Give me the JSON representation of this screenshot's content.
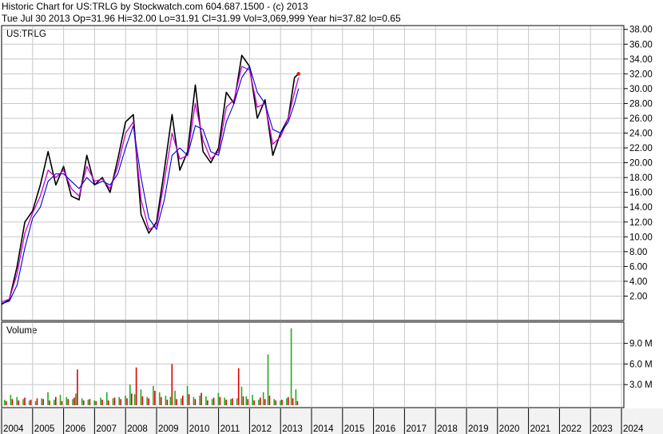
{
  "header": {
    "line1": "Historic Chart for US:TRLG by Stockwatch.com 604.687.1500 - (c) 2013",
    "line2": "Tue Jul 30 2013   Op=31.96   Hi=32.00   Lo=31.91   Cl=31.99   Vol=3,069,999   Year hi=37.82   lo=0.65"
  },
  "colors": {
    "price": "#000000",
    "ma_fast": "#cc00cc",
    "ma_slow": "#0000cc",
    "volume_up": "#22aa22",
    "volume_down": "#dd0000",
    "grid": "#c8c8c8"
  },
  "chart_data": [
    {
      "type": "line",
      "label": "US:TRLG",
      "ylim": [
        0,
        39
      ],
      "y_ticks": [
        "2.00",
        "4.00",
        "6.00",
        "8.00",
        "10.00",
        "12.00",
        "14.00",
        "16.00",
        "18.00",
        "20.00",
        "22.00",
        "24.00",
        "26.00",
        "28.00",
        "30.00",
        "32.00",
        "34.00",
        "36.00",
        "38.00"
      ],
      "x": [
        2004.0,
        2004.25,
        2004.5,
        2004.75,
        2005.0,
        2005.25,
        2005.5,
        2005.75,
        2006.0,
        2006.25,
        2006.5,
        2006.75,
        2007.0,
        2007.25,
        2007.5,
        2007.75,
        2008.0,
        2008.25,
        2008.5,
        2008.75,
        2009.0,
        2009.25,
        2009.5,
        2009.75,
        2010.0,
        2010.25,
        2010.5,
        2010.75,
        2011.0,
        2011.25,
        2011.5,
        2011.75,
        2012.0,
        2012.25,
        2012.5,
        2012.75,
        2013.0,
        2013.25,
        2013.45,
        2013.58
      ],
      "series": [
        {
          "values": [
            0.9,
            1.5,
            6.0,
            12.0,
            13.5,
            17.0,
            21.5,
            17.0,
            19.5,
            15.5,
            15.0,
            21.0,
            17.0,
            18.0,
            16.0,
            20.5,
            25.5,
            26.5,
            13.0,
            10.5,
            12.0,
            19.0,
            26.5,
            19.0,
            21.5,
            30.5,
            21.5,
            20.0,
            22.0,
            29.5,
            28.0,
            34.5,
            33.0,
            26.0,
            28.5,
            21.0,
            24.0,
            26.0,
            31.5,
            32.0
          ]
        },
        {
          "values": [
            1.2,
            1.6,
            5.0,
            10.5,
            13.2,
            15.5,
            19.0,
            18.0,
            19.0,
            16.5,
            15.5,
            19.5,
            17.5,
            17.8,
            16.5,
            19.5,
            24.0,
            25.5,
            15.0,
            11.0,
            11.5,
            17.5,
            24.0,
            20.5,
            21.0,
            28.0,
            23.0,
            20.5,
            21.5,
            27.5,
            28.5,
            33.0,
            32.5,
            27.5,
            28.0,
            22.5,
            23.5,
            26.0,
            29.5,
            31.5
          ]
        },
        {
          "values": [
            1.0,
            1.3,
            3.5,
            8.5,
            12.5,
            14.0,
            17.5,
            18.5,
            18.5,
            17.5,
            16.5,
            18.0,
            17.0,
            17.5,
            17.0,
            18.5,
            22.0,
            25.0,
            18.0,
            12.5,
            11.0,
            15.0,
            21.0,
            22.0,
            21.0,
            25.0,
            24.5,
            21.5,
            21.0,
            25.5,
            28.0,
            31.5,
            33.0,
            29.5,
            28.0,
            24.5,
            24.0,
            25.5,
            28.0,
            30.0
          ]
        }
      ]
    },
    {
      "type": "bar",
      "label": "Volume",
      "ylim": [
        0,
        11500000
      ],
      "y_ticks": [
        "3.0 M",
        "6.0 M",
        "9.0 M"
      ],
      "x": [
        2004.1,
        2004.3,
        2004.5,
        2004.7,
        2004.9,
        2005.1,
        2005.3,
        2005.5,
        2005.7,
        2005.9,
        2006.1,
        2006.3,
        2006.4,
        2006.6,
        2006.8,
        2007.0,
        2007.2,
        2007.4,
        2007.6,
        2007.8,
        2008.0,
        2008.15,
        2008.3,
        2008.5,
        2008.7,
        2008.9,
        2009.1,
        2009.3,
        2009.45,
        2009.6,
        2009.8,
        2010.0,
        2010.2,
        2010.4,
        2010.6,
        2010.8,
        2011.0,
        2011.2,
        2011.4,
        2011.6,
        2011.75,
        2011.9,
        2012.1,
        2012.3,
        2012.45,
        2012.6,
        2012.8,
        2013.0,
        2013.2,
        2013.35,
        2013.5
      ],
      "series": [
        {
          "name": "up",
          "values": [
            800000,
            1500000,
            1200000,
            900000,
            700000,
            600000,
            1000000,
            1900000,
            800000,
            1500000,
            1200000,
            900000,
            1700000,
            1000000,
            800000,
            700000,
            1100000,
            1900000,
            1000000,
            1200000,
            1400000,
            3000000,
            1600000,
            2300000,
            1200000,
            2800000,
            1900000,
            1400000,
            1200000,
            2100000,
            1000000,
            2800000,
            1200000,
            1400000,
            1300000,
            900000,
            1800000,
            1100000,
            900000,
            1000000,
            2700000,
            1300000,
            1500000,
            800000,
            1900000,
            7400000,
            900000,
            700000,
            1000000,
            11200000,
            2300000
          ]
        },
        {
          "name": "down",
          "values": [
            600000,
            900000,
            700000,
            1100000,
            800000,
            1000000,
            900000,
            700000,
            1200000,
            600000,
            900000,
            1100000,
            5200000,
            700000,
            900000,
            600000,
            800000,
            700000,
            1100000,
            900000,
            1000000,
            1700000,
            5500000,
            1300000,
            1000000,
            2100000,
            1200000,
            800000,
            6000000,
            900000,
            1400000,
            1600000,
            900000,
            1800000,
            700000,
            1100000,
            1200000,
            800000,
            1000000,
            5400000,
            1300000,
            900000,
            700000,
            1100000,
            900000,
            1400000,
            700000,
            800000,
            1200000,
            1000000,
            600000
          ]
        }
      ]
    }
  ],
  "x_axis": {
    "years": [
      "2004",
      "2005",
      "2006",
      "2007",
      "2008",
      "2009",
      "2010",
      "2011",
      "2012",
      "2013",
      "2014",
      "2015",
      "2016",
      "2017",
      "2018",
      "2019",
      "2020",
      "2021",
      "2022",
      "2023",
      "2024"
    ]
  }
}
